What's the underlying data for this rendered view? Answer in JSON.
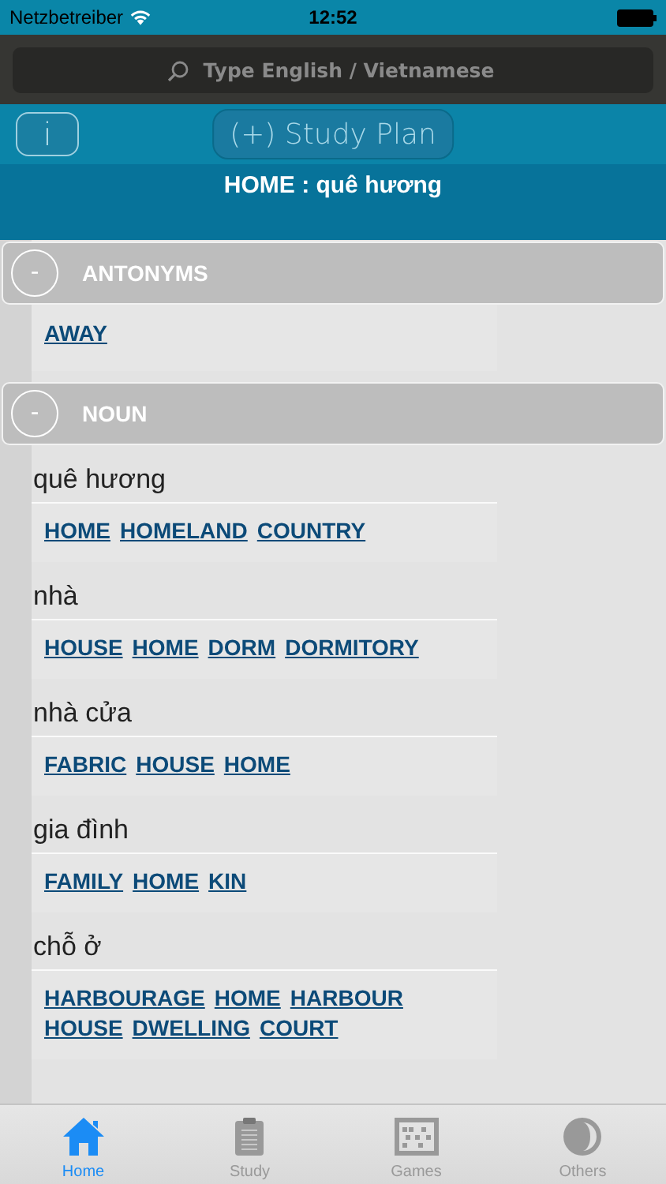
{
  "status_bar": {
    "carrier": "Netzbetreiber",
    "time": "12:52"
  },
  "search": {
    "placeholder": "Type English / Vietnamese"
  },
  "info_button": "i",
  "study_plan_button": "(+) Study Plan",
  "heading": "HOME : quê hương",
  "sections": [
    {
      "title": "ANTONYMS",
      "toggle": "-",
      "entries": [
        {
          "words": [
            "AWAY"
          ]
        }
      ]
    },
    {
      "title": "NOUN",
      "toggle": "-",
      "entries": [
        {
          "meaning": "quê hương",
          "words": [
            "HOME",
            "HOMELAND",
            "COUNTRY"
          ]
        },
        {
          "meaning": "nhà",
          "words": [
            "HOUSE",
            "HOME",
            "DORM",
            "DORMITORY"
          ]
        },
        {
          "meaning": "nhà cửa",
          "words": [
            "FABRIC",
            "HOUSE",
            "HOME"
          ]
        },
        {
          "meaning": "gia đình",
          "words": [
            "FAMILY",
            "HOME",
            "KIN"
          ]
        },
        {
          "meaning": "chỗ ở",
          "words": [
            "HARBOURAGE",
            "HOME",
            "HARBOUR",
            "HOUSE",
            "DWELLING",
            "COURT"
          ]
        }
      ]
    }
  ],
  "tabs": [
    {
      "label": "Home",
      "kind": "house",
      "selected": true
    },
    {
      "label": "Study",
      "kind": "clipboard",
      "selected": false
    },
    {
      "label": "Games",
      "kind": "abacus",
      "selected": false
    },
    {
      "label": "Others",
      "kind": "halfcircle",
      "selected": false
    }
  ]
}
